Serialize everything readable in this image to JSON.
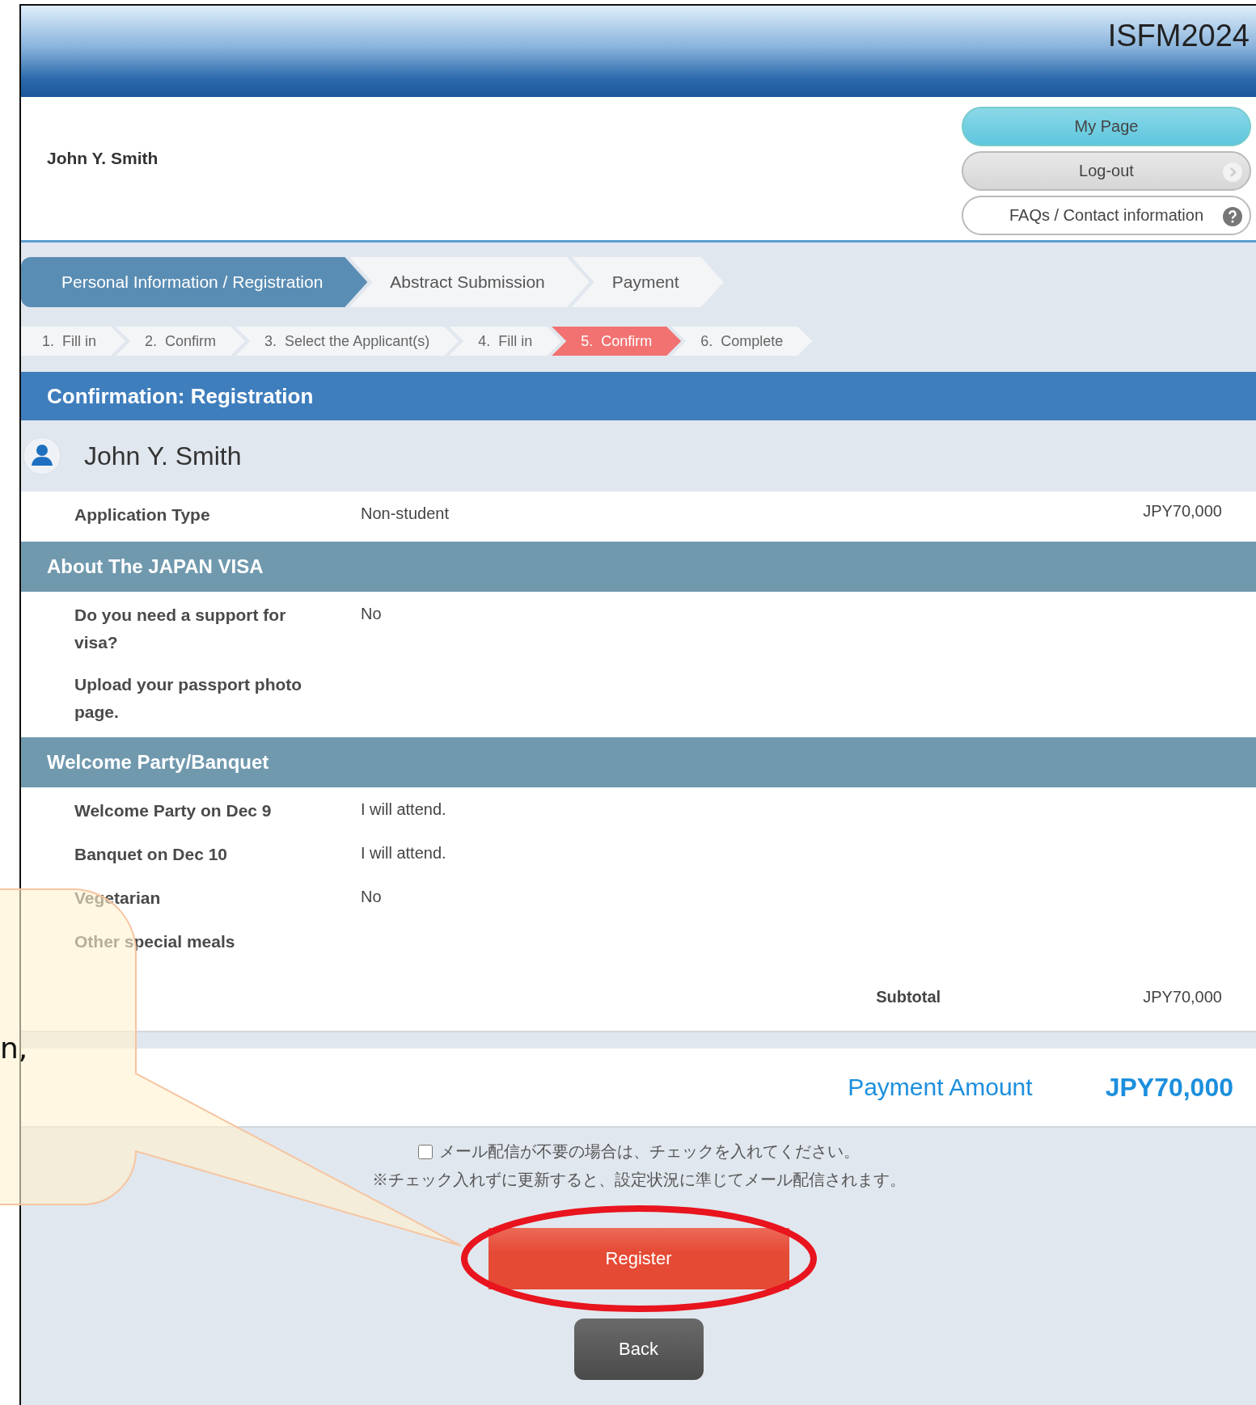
{
  "header": {
    "title": "ISFM2024"
  },
  "user": {
    "name": "John Y. Smith"
  },
  "nav_buttons": [
    {
      "label": "My Page",
      "kind": "primary"
    },
    {
      "label": "Log-out",
      "kind": "logout"
    },
    {
      "label": "FAQs / Contact information",
      "kind": "help"
    }
  ],
  "tabs": [
    {
      "label": "Personal Information / Registration",
      "selected": true
    },
    {
      "label": "Abstract Submission",
      "selected": false
    },
    {
      "label": "Payment",
      "selected": false
    }
  ],
  "steps": [
    {
      "label": "1.  Fill in",
      "selected": false
    },
    {
      "label": "2.  Confirm",
      "selected": false
    },
    {
      "label": "3.  Select the Applicant(s)",
      "selected": false
    },
    {
      "label": "4.  Fill in",
      "selected": false
    },
    {
      "label": "5.  Confirm",
      "selected": true
    },
    {
      "label": "6.  Complete",
      "selected": false
    }
  ],
  "page_title": "Confirmation: Registration",
  "applicant": {
    "name": "John Y. Smith"
  },
  "sections": [
    {
      "rows": [
        {
          "label": "Application Type",
          "value": "Non-student",
          "price": "JPY70,000"
        }
      ]
    },
    {
      "title": "About The JAPAN VISA",
      "rows": [
        {
          "label": "Do you need a support for visa?",
          "value": "No"
        },
        {
          "label": "Upload your passport photo page."
        }
      ]
    },
    {
      "title": "Welcome Party/Banquet",
      "rows": [
        {
          "label": "Welcome Party on Dec 9",
          "value": "I will attend."
        },
        {
          "label": "Banquet on Dec 10",
          "value": "I will attend."
        },
        {
          "label": "Vegetarian",
          "value": "No"
        },
        {
          "label": "Other special meals"
        }
      ]
    }
  ],
  "subtotal": {
    "label": "Subtotal",
    "amount": "JPY70,000"
  },
  "payment": {
    "label": "Payment Amount",
    "amount": "JPY70,000"
  },
  "mail_opt_out": {
    "checked": false,
    "label": "メール配信が不要の場合は、チェックを入れてください。",
    "note": "※チェック入れずに更新すると、設定状況に準じてメール配信されます。"
  },
  "buttons": [
    {
      "label": "Register",
      "kind": "register"
    },
    {
      "label": "Back",
      "kind": "back"
    }
  ],
  "callout": {
    "lines": [
      "n,"
    ]
  }
}
